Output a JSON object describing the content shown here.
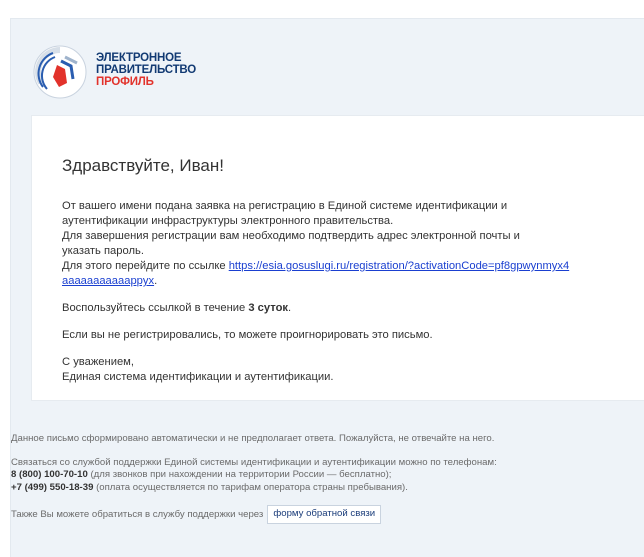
{
  "brand": {
    "line1": "ЭЛЕКТРОННОЕ",
    "line2": "ПРАВИТЕЛЬСТВО",
    "line3": "ПРОФИЛЬ",
    "emblem_icon": "gos-emblem-icon",
    "colors": {
      "blue": "#123a73",
      "red": "#e2322b"
    }
  },
  "email": {
    "greeting": "Здравствуйте, Иван!",
    "intro_line1": "От вашего имени подана заявка на регистрацию в Единой системе идентификации и",
    "intro_line2": "аутентификации инфраструктуры электронного правительства.",
    "confirm_line1": "Для завершения регистрации вам необходимо подтвердить адрес электронной почты и",
    "confirm_line2": "указать пароль.",
    "link_prefix": "Для этого перейдите по ссылке ",
    "link_text": "https://esia.gosuslugi.ru/registration/?activationCode=pf8gpwynmyx4aaaaaaaaaaappyx",
    "link_suffix": ".",
    "validity_prefix": "Воспользуйтесь ссылкой в течение ",
    "validity_bold": "3 суток",
    "validity_suffix": ".",
    "ignore_text": "Если вы не регистрировались, то можете проигнорировать это письмо.",
    "signoff_line1": "С уважением,",
    "signoff_line2": "Единая система идентификации и аутентификации."
  },
  "footer": {
    "auto_notice": "Данное письмо сформировано автоматически и не предполагает ответа. Пожалуйста, не отвечайте на него.",
    "support_intro": "Связаться со службой поддержки Единой системы идентификации и аутентификации можно по телефонам:",
    "phone1": "8 (800) 100-70-10",
    "phone1_note": " (для звонков при нахождении на территории России — бесплатно);",
    "phone2": "+7 (499) 550-18-39",
    "phone2_note": " (оплата осуществляется по тарифам оператора страны пребывания).",
    "feedback_prefix": "Также Вы можете обратиться в службу поддержки через",
    "feedback_button": "форму обратной связи"
  }
}
